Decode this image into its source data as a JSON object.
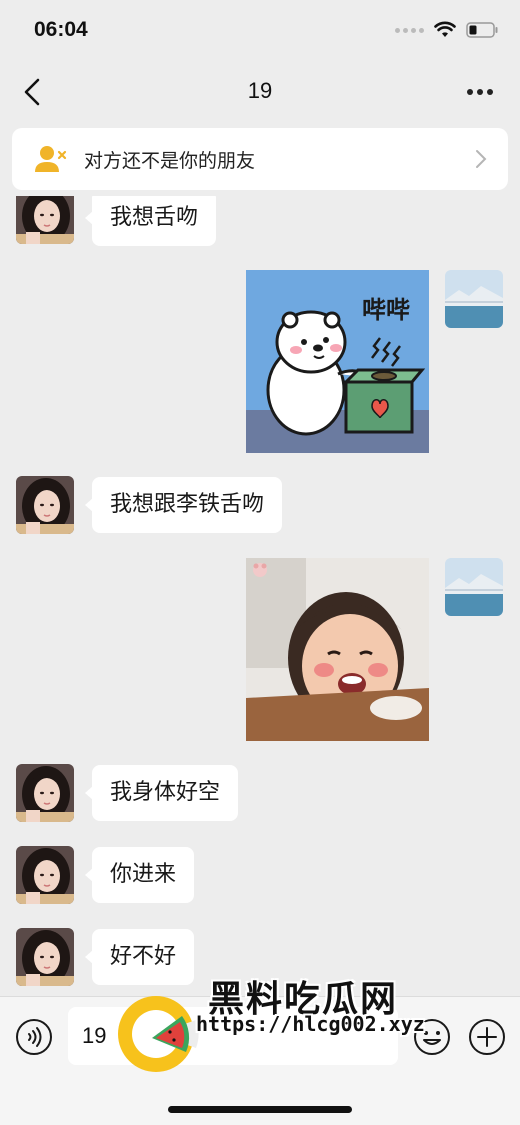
{
  "status_bar": {
    "time": "06:04"
  },
  "header": {
    "title": "19"
  },
  "banner": {
    "text": "对方还不是你的朋友"
  },
  "messages": [
    {
      "side": "left",
      "type": "text",
      "text": "我想舌吻"
    },
    {
      "side": "right",
      "type": "sticker",
      "sticker_text": "哔哔"
    },
    {
      "side": "left",
      "type": "text",
      "text": "我想跟李铁舌吻"
    },
    {
      "side": "right",
      "type": "sticker"
    },
    {
      "side": "left",
      "type": "text",
      "text": "我身体好空"
    },
    {
      "side": "left",
      "type": "text",
      "text": "你进来"
    },
    {
      "side": "left",
      "type": "text",
      "text": "好不好"
    }
  ],
  "input": {
    "value": "19"
  },
  "watermark": {
    "name": "黑料吃瓜网",
    "url": "https://hlcg002.xyz"
  },
  "colors": {
    "background": "#ededed",
    "bubble_left": "#ffffff",
    "banner_icon": "#f0b429",
    "watermark_yellow": "#f7c21c",
    "watermark_green": "#3ba55d",
    "watermark_red": "#e0413c"
  }
}
